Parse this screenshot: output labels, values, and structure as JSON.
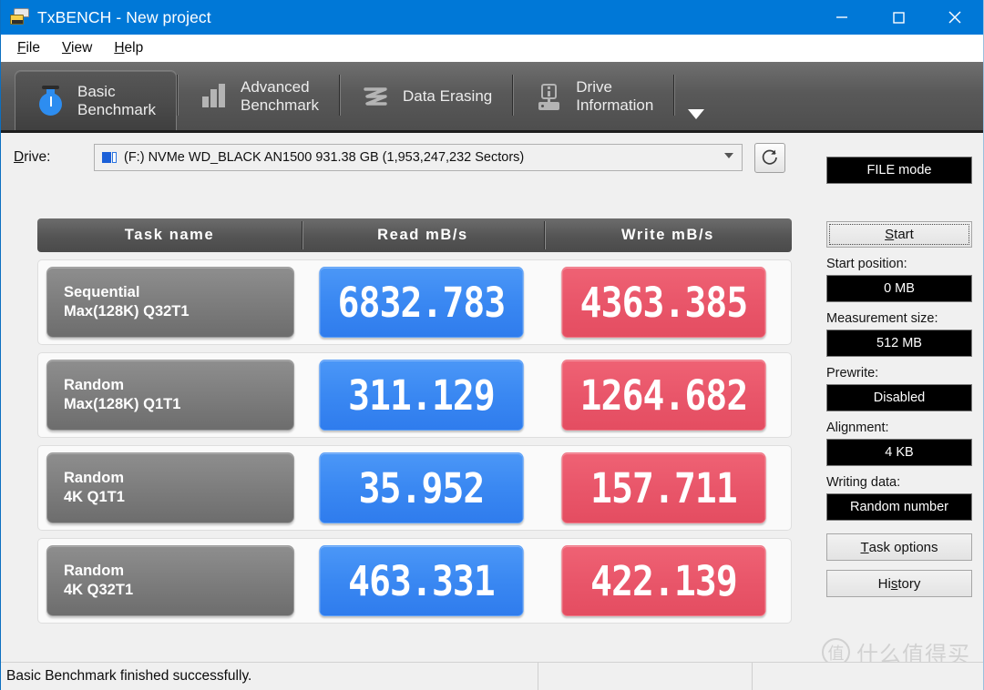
{
  "window": {
    "title": "TxBENCH - New project",
    "app_icon": "drive-icon",
    "controls": {
      "minimize": "minimize-icon",
      "maximize": "maximize-icon",
      "close": "close-icon"
    },
    "accent_color": "#0078d7"
  },
  "menu": [
    {
      "pre": "",
      "accel": "F",
      "post": "ile"
    },
    {
      "pre": "",
      "accel": "V",
      "post": "iew"
    },
    {
      "pre": "",
      "accel": "H",
      "post": "elp"
    }
  ],
  "tabs": [
    {
      "line1": "Basic",
      "line2": "Benchmark",
      "icon": "stopwatch-icon",
      "active": true
    },
    {
      "line1": "Advanced",
      "line2": "Benchmark",
      "icon": "bar-chart-icon",
      "active": false
    },
    {
      "line1": "Data Erasing",
      "line2": "",
      "icon": "erase-icon",
      "active": false
    },
    {
      "line1": "Drive",
      "line2": "Information",
      "icon": "drive-info-icon",
      "active": false
    }
  ],
  "tab_overflow_icon": "chevron-down-icon",
  "drive": {
    "label_pre": "",
    "label_accel": "D",
    "label_post": "rive:",
    "selected": "(F:) NVMe WD_BLACK AN1500  931.38 GB (1,953,247,232 Sectors)",
    "icon": "drive-small-icon",
    "refresh_icon": "refresh-icon"
  },
  "table": {
    "headers": [
      "Task name",
      "Read mB/s",
      "Write mB/s"
    ],
    "rows": [
      {
        "name_line1": "Sequential",
        "name_line2": "Max(128K) Q32T1",
        "read": "6832.783",
        "write": "4363.385"
      },
      {
        "name_line1": "Random",
        "name_line2": "Max(128K) Q1T1",
        "read": "311.129",
        "write": "1264.682"
      },
      {
        "name_line1": "Random",
        "name_line2": "4K Q1T1",
        "read": "35.952",
        "write": "157.711"
      },
      {
        "name_line1": "Random",
        "name_line2": "4K Q32T1",
        "read": "463.331",
        "write": "422.139"
      }
    ],
    "read_color": "#3a88f2",
    "write_color": "#e9566a"
  },
  "panel": {
    "mode_button": "FILE mode",
    "start_pre": "",
    "start_accel": "S",
    "start_post": "tart",
    "start_position_label": "Start position:",
    "start_position_value": "0 MB",
    "measurement_size_label": "Measurement size:",
    "measurement_size_value": "512 MB",
    "prewrite_label": "Prewrite:",
    "prewrite_value": "Disabled",
    "alignment_label": "Alignment:",
    "alignment_value": "4 KB",
    "writing_data_label": "Writing data:",
    "writing_data_value": "Random number",
    "task_options_pre": "",
    "task_options_accel": "T",
    "task_options_post": "ask options",
    "history_pre": "Hi",
    "history_accel": "s",
    "history_post": "tory"
  },
  "status": {
    "message": "Basic Benchmark finished successfully."
  },
  "watermark": {
    "badge": "值",
    "text": "什么值得买"
  }
}
